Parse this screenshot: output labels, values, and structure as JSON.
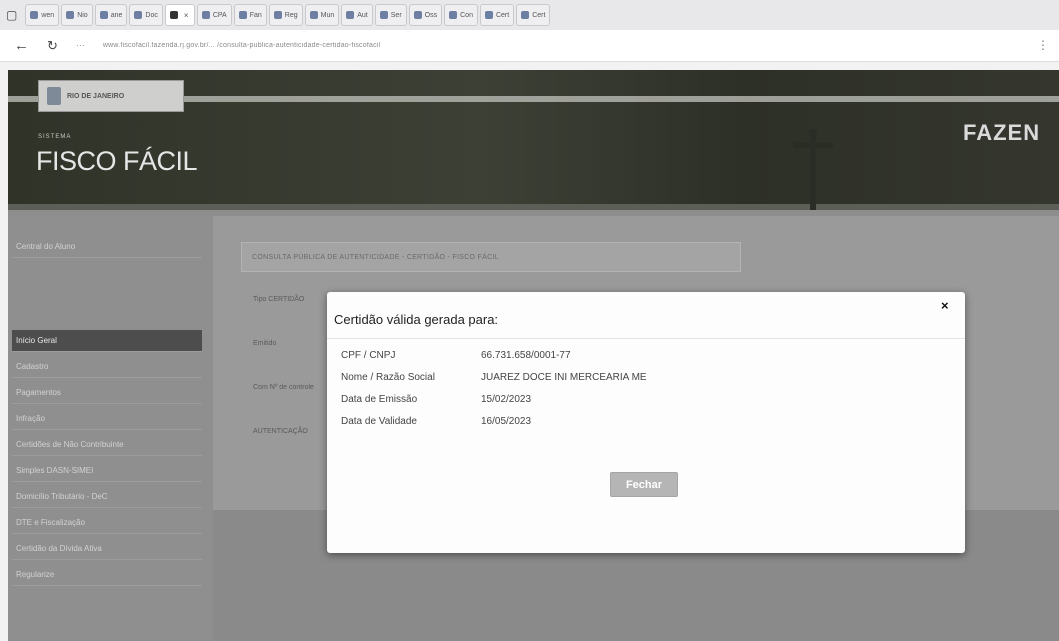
{
  "browser": {
    "tabs": [
      {
        "label": "wen",
        "active": false
      },
      {
        "label": "Nio",
        "active": false
      },
      {
        "label": "ane",
        "active": false
      },
      {
        "label": "Doc",
        "active": false
      },
      {
        "label": "",
        "active": true
      },
      {
        "label": "CPA",
        "active": false
      },
      {
        "label": "Fan",
        "active": false
      },
      {
        "label": "Reg",
        "active": false
      },
      {
        "label": "Mun",
        "active": false
      },
      {
        "label": "Aut",
        "active": false
      },
      {
        "label": "Ser",
        "active": false
      },
      {
        "label": "Oss",
        "active": false
      },
      {
        "label": "Con",
        "active": false
      },
      {
        "label": "Cert",
        "active": false
      },
      {
        "label": "Cert",
        "active": false
      }
    ],
    "url": "www.fiscofacil.fazenda.rj.gov.br/... /consulta-publica-autenticidade-certidao-fiscofacil"
  },
  "header": {
    "logo_text": "RIO DE JANEIRO",
    "system_label": "SISTEMA",
    "app_name": "FISCO FÁCIL",
    "org_name_partial": "FAZEN"
  },
  "sidebar": {
    "items": [
      {
        "label": "Central do Aluno",
        "selected": false
      },
      {
        "label": "Início Geral",
        "selected": true
      },
      {
        "label": "Cadastro",
        "selected": false
      },
      {
        "label": "Pagamentos",
        "selected": false
      },
      {
        "label": "Infração",
        "selected": false
      },
      {
        "label": "Certidões de Não Contribuinte",
        "selected": false
      },
      {
        "label": "Simples DASN-SIMEI",
        "selected": false
      },
      {
        "label": "Domicílio Tributário - DeC",
        "selected": false
      },
      {
        "label": "DTE e Fiscalização",
        "selected": false
      },
      {
        "label": "Certidão da Dívida Ativa",
        "selected": false
      },
      {
        "label": "Regularize",
        "selected": false
      }
    ]
  },
  "content": {
    "breadcrumb": "CONSULTA PÚBLICA DE AUTENTICIDADE - CERTIDÃO - FISCO FÁCIL",
    "labels": [
      "Tipo CERTIDÃO",
      "Emitido",
      "Com Nº de controle",
      "AUTENTICAÇÃO"
    ]
  },
  "modal": {
    "title": "Certidão válida gerada para:",
    "close_symbol": "×",
    "rows": [
      {
        "label": "CPF / CNPJ",
        "value": "66.731.658/0001-77"
      },
      {
        "label": "Nome / Razão Social",
        "value": "JUAREZ DOCE INI MERCEARIA ME"
      },
      {
        "label": "Data de Emissão",
        "value": "15/02/2023"
      },
      {
        "label": "Data de Validade",
        "value": "16/05/2023"
      }
    ],
    "close_button": "Fechar"
  },
  "colors": {
    "header_bg": "#3c4035",
    "overlay_gray": "#9a9a9a",
    "button_gray": "#b5b5b5"
  }
}
